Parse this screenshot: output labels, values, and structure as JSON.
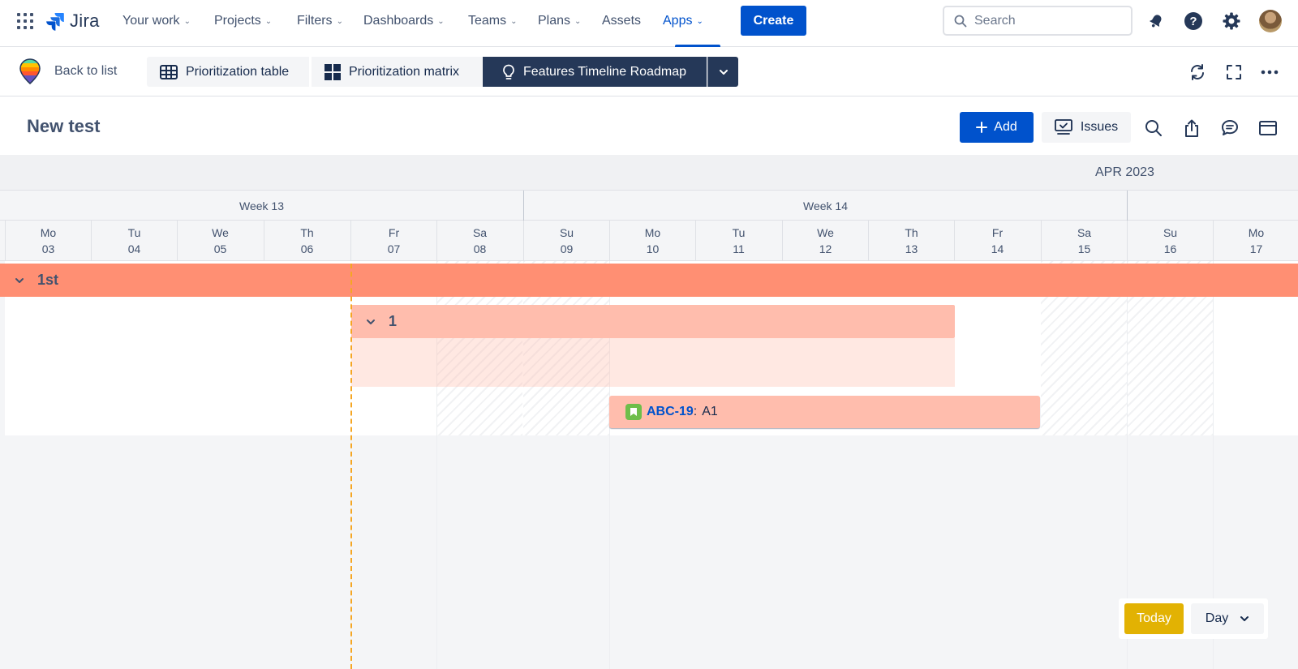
{
  "topnav": {
    "logo_text": "Jira",
    "items": [
      {
        "label": "Your work",
        "has_dropdown": true
      },
      {
        "label": "Projects",
        "has_dropdown": true
      },
      {
        "label": "Filters",
        "has_dropdown": true
      },
      {
        "label": "Dashboards",
        "has_dropdown": true
      },
      {
        "label": "Teams",
        "has_dropdown": true
      },
      {
        "label": "Plans",
        "has_dropdown": true
      },
      {
        "label": "Assets",
        "has_dropdown": false
      },
      {
        "label": "Apps",
        "has_dropdown": true,
        "active": true
      }
    ],
    "create_label": "Create",
    "search_placeholder": "Search",
    "icons": [
      "notifications-icon",
      "help-icon",
      "settings-icon",
      "avatar"
    ]
  },
  "subbar": {
    "back_label": "Back to list",
    "tabs": [
      {
        "label": "Prioritization table",
        "icon": "table-icon"
      },
      {
        "label": "Prioritization matrix",
        "icon": "matrix-icon"
      },
      {
        "label": "Features Timeline Roadmap",
        "icon": "lightbulb-icon",
        "active": true
      }
    ],
    "right_icons": [
      "sync-icon",
      "fullscreen-icon",
      "more-icon"
    ]
  },
  "page": {
    "title": "New test",
    "add_label": "Add",
    "issues_label": "Issues"
  },
  "timeline": {
    "month": "APR 2023",
    "weeks": [
      "Week 13",
      "Week 14"
    ],
    "days": [
      {
        "dow": "Mo",
        "date": "03"
      },
      {
        "dow": "Tu",
        "date": "04"
      },
      {
        "dow": "We",
        "date": "05"
      },
      {
        "dow": "Th",
        "date": "06"
      },
      {
        "dow": "Fr",
        "date": "07"
      },
      {
        "dow": "Sa",
        "date": "08"
      },
      {
        "dow": "Su",
        "date": "09"
      },
      {
        "dow": "Mo",
        "date": "10"
      },
      {
        "dow": "Tu",
        "date": "11"
      },
      {
        "dow": "We",
        "date": "12"
      },
      {
        "dow": "Th",
        "date": "13"
      },
      {
        "dow": "Fr",
        "date": "14"
      },
      {
        "dow": "Sa",
        "date": "15"
      },
      {
        "dow": "Su",
        "date": "16"
      },
      {
        "dow": "Mo",
        "date": "17"
      }
    ],
    "group_label": "1st",
    "subgroup_label": "1",
    "issue": {
      "key": "ABC-19",
      "separator": ":",
      "summary": "A1"
    }
  },
  "controls": {
    "today_label": "Today",
    "scale_label": "Day"
  },
  "colors": {
    "brand_blue": "#0052cc",
    "group_orange": "#ff8f73",
    "bar_salmon": "#ffbdad",
    "today_yellow": "#e2b203",
    "story_green": "#6ebe4a"
  }
}
